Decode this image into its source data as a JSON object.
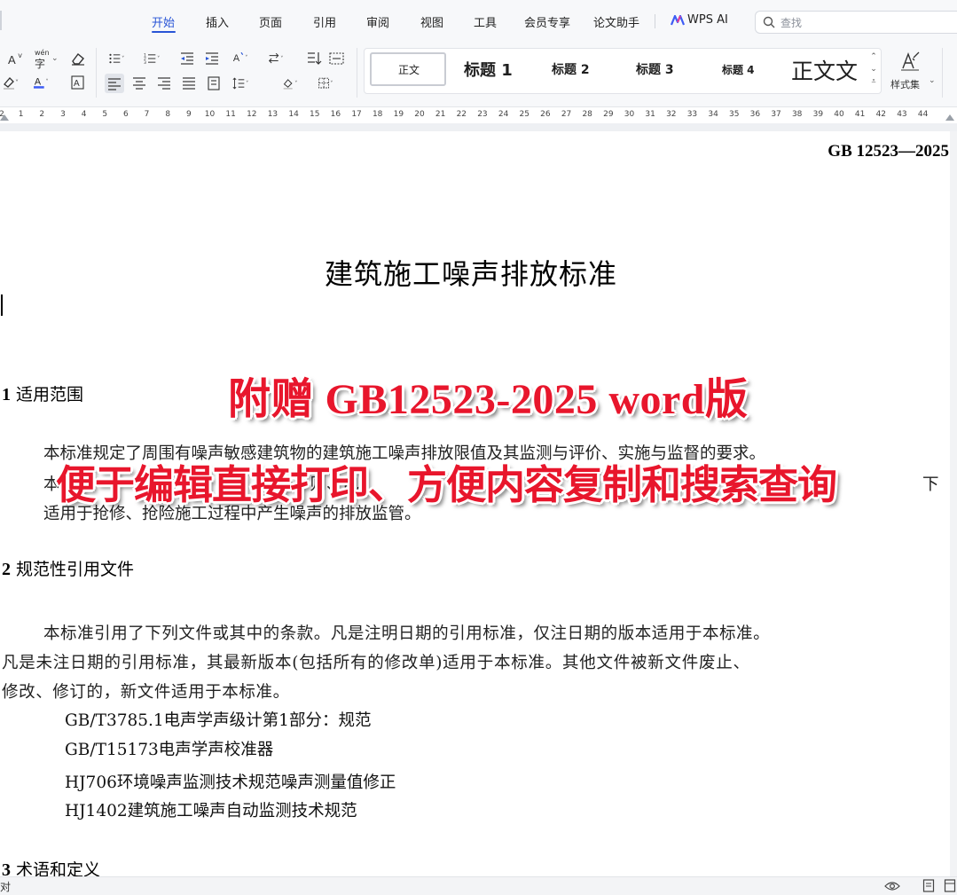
{
  "menu": {
    "tabs": [
      "开始",
      "插入",
      "页面",
      "引用",
      "审阅",
      "视图",
      "工具",
      "会员专享",
      "论文助手"
    ],
    "ai_label": "WPS AI",
    "search_placeholder": "查找"
  },
  "ribbon": {
    "font_pinyin_label": "wén",
    "font_pinyin_char": "字",
    "styles": [
      {
        "label": "正文"
      },
      {
        "label": "标题 1"
      },
      {
        "label": "标题 2"
      },
      {
        "label": "标题 3"
      },
      {
        "label": "标题 4"
      },
      {
        "label": "正文文"
      }
    ],
    "style_set_label": "样式集"
  },
  "ruler": {
    "marks": [
      "2",
      "1",
      "2",
      "3",
      "4",
      "5",
      "6",
      "7",
      "8",
      "9",
      "10",
      "11",
      "12",
      "13",
      "14",
      "15",
      "16",
      "17",
      "18",
      "19",
      "20",
      "21",
      "22",
      "23",
      "24",
      "25",
      "26",
      "27",
      "28",
      "29",
      "30",
      "31",
      "32",
      "33",
      "34",
      "35",
      "36",
      "37",
      "38",
      "39",
      "40",
      "41",
      "42",
      "43",
      "44"
    ]
  },
  "document": {
    "header_code": "GB 12523—2025",
    "title": "建筑施工噪声排放标准",
    "sections": [
      {
        "num": "1",
        "title": "适用范围"
      },
      {
        "num": "2",
        "title": "规范性引用文件"
      },
      {
        "num": "3",
        "title": "术语和定义"
      }
    ],
    "scope_p1": "本标准规定了周围有噪声敏感建筑物的建筑施工噪声排放限值及其监测与评价、实施与监督的要求。",
    "scope_p2_start": "本",
    "scope_p2_mid": "值 则、电",
    "scope_p2_end": "下",
    "scope_p2_line2": "适用于抢修、抢险施工过程中产生噪声的排放监管。",
    "ref_p1_line1": "本标准引用了下列文件或其中的条款。凡是注明日期的引用标准，仅注日期的版本适用于本标准。",
    "ref_p1_line2": "凡是未注日期的引用标准，其最新版本(包括所有的修改单)适用于本标准。其他文件被新文件废止、",
    "ref_p1_line3": "修改、修订的，新文件适用于本标准。",
    "references": [
      "GB/T3785.1电声学声级计第1部分：规范",
      "GB/T15173电声学声校准器",
      "HJ706环境噪声监测技术规范噪声测量值修正",
      "HJ1402建筑施工噪声自动监测技术规范"
    ]
  },
  "overlay": {
    "line1": "附赠 GB12523-2025 word版",
    "line2": "便于编辑直接打印、方便内容复制和搜索查询"
  },
  "statusbar": {
    "left_text": "对"
  },
  "colors": {
    "accent": "#2955d6",
    "promo_red": "#e8162c",
    "ribbon_bg": "#f7f8fa"
  }
}
